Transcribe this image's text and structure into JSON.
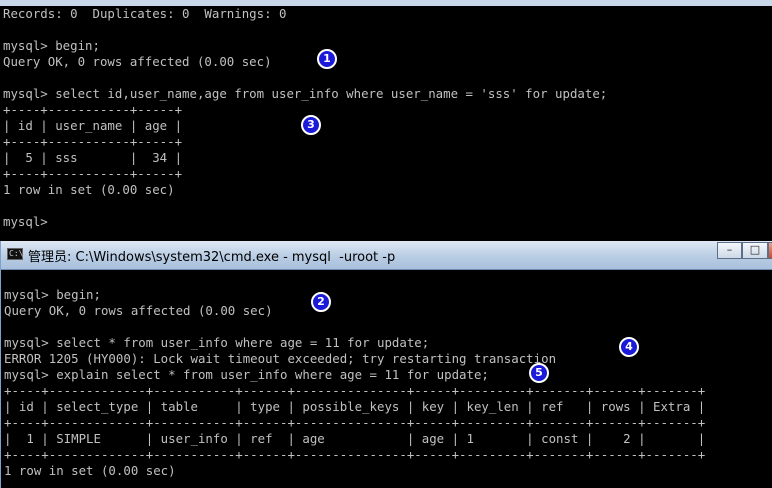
{
  "window1": {
    "title_partial": "C:\\Windows\\system32\\cmd.exe - mysql -uroot -p",
    "lines": [
      "Records: 0  Duplicates: 0  Warnings: 0",
      "",
      "mysql> begin;",
      "Query OK, 0 rows affected (0.00 sec)",
      "",
      "mysql> select id,user_name,age from user_info where user_name = 'sss' for update;",
      "+----+-----------+-----+",
      "| id | user_name | age |",
      "+----+-----------+-----+",
      "|  5 | sss       |  34 |",
      "+----+-----------+-----+",
      "1 row in set (0.00 sec)",
      "",
      "mysql>"
    ]
  },
  "window2": {
    "title": "管理员: C:\\Windows\\system32\\cmd.exe - mysql  -uroot -p",
    "icon_text": "C:\\",
    "controls": {
      "minimize": "–",
      "maximize": "□",
      "close": ""
    },
    "lines": [
      "mysql> begin;",
      "Query OK, 0 rows affected (0.00 sec)",
      "",
      "mysql> select * from user_info where age = 11 for update;",
      "ERROR 1205 (HY000): Lock wait timeout exceeded; try restarting transaction",
      "mysql> explain select * from user_info where age = 11 for update;",
      "+----+-------------+-----------+------+---------------+-----+---------+-------+------+-------+",
      "| id | select_type | table     | type | possible_keys | key | key_len | ref   | rows | Extra |",
      "+----+-------------+-----------+------+---------------+-----+---------+-------+------+-------+",
      "|  1 | SIMPLE      | user_info | ref  | age           | age | 1       | const |    2 |       |",
      "+----+-------------+-----------+------+---------------+-----+---------+-------+------+-------+",
      "1 row in set (0.00 sec)"
    ]
  },
  "annotations": [
    "1",
    "2",
    "3",
    "4",
    "5"
  ],
  "colors": {
    "terminal_bg": "#000000",
    "terminal_fg": "#c0c0c0",
    "badge": "#1a1ad8"
  }
}
